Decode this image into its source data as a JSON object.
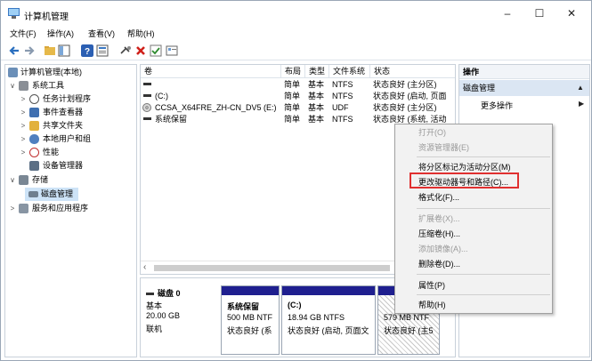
{
  "window": {
    "title": "计算机管理",
    "min": "–",
    "max": "☐",
    "close": "✕"
  },
  "menu": [
    "文件(F)",
    "操作(A)",
    "查看(V)",
    "帮助(H)"
  ],
  "tree": {
    "root": "计算机管理(本地)",
    "items": [
      {
        "label": "系统工具",
        "exp": "∨"
      },
      {
        "label": "任务计划程序",
        "exp": ">"
      },
      {
        "label": "事件查看器",
        "exp": ">"
      },
      {
        "label": "共享文件夹",
        "exp": ">"
      },
      {
        "label": "本地用户和组",
        "exp": ">"
      },
      {
        "label": "性能",
        "exp": ">"
      },
      {
        "label": "设备管理器",
        "exp": ""
      },
      {
        "label": "存储",
        "exp": "∨"
      },
      {
        "label": "磁盘管理",
        "exp": ""
      },
      {
        "label": "服务和应用程序",
        "exp": ">"
      }
    ]
  },
  "columns": [
    "卷",
    "布局",
    "类型",
    "文件系统",
    "状态"
  ],
  "volumes": [
    {
      "name": "",
      "layout": "简单",
      "type": "基本",
      "fs": "NTFS",
      "status": "状态良好 (主分区)"
    },
    {
      "name": "(C:)",
      "layout": "简单",
      "type": "基本",
      "fs": "NTFS",
      "status": "状态良好 (启动, 页面"
    },
    {
      "name": "CCSA_X64FRE_ZH-CN_DV5 (E:)",
      "layout": "简单",
      "type": "基本",
      "fs": "UDF",
      "status": "状态良好 (主分区)"
    },
    {
      "name": "系统保留",
      "layout": "简单",
      "type": "基本",
      "fs": "NTFS",
      "status": "状态良好 (系统, 活动"
    }
  ],
  "disk": {
    "name": "磁盘 0",
    "type": "基本",
    "size": "20.00 GB",
    "state": "联机"
  },
  "partitions": [
    {
      "name": "系统保留",
      "size": "500 MB NTF",
      "status": "状态良好 (系"
    },
    {
      "name": "(C:)",
      "size": "18.94 GB NTFS",
      "status": "状态良好 (启动, 页面文"
    },
    {
      "name": "",
      "size": "579 MB NTF",
      "status": "状态良好 (主5"
    }
  ],
  "actions": {
    "header": "操作",
    "section": "磁盘管理",
    "more": "更多操作"
  },
  "context_menu": [
    {
      "label": "打开(O)",
      "enabled": false
    },
    {
      "label": "资源管理器(E)",
      "enabled": false
    },
    {
      "label": "将分区标记为活动分区(M)",
      "enabled": true
    },
    {
      "label": "更改驱动器号和路径(C)...",
      "enabled": true
    },
    {
      "label": "格式化(F)...",
      "enabled": true
    },
    {
      "label": "扩展卷(X)...",
      "enabled": false
    },
    {
      "label": "压缩卷(H)...",
      "enabled": true
    },
    {
      "label": "添加镜像(A)...",
      "enabled": false
    },
    {
      "label": "删除卷(D)...",
      "enabled": true
    },
    {
      "label": "属性(P)",
      "enabled": true
    },
    {
      "label": "帮助(H)",
      "enabled": true
    }
  ],
  "colors": {
    "accent": "#1f1f8f",
    "highlight_box": "#e03030",
    "selection": "#cde3f7"
  }
}
